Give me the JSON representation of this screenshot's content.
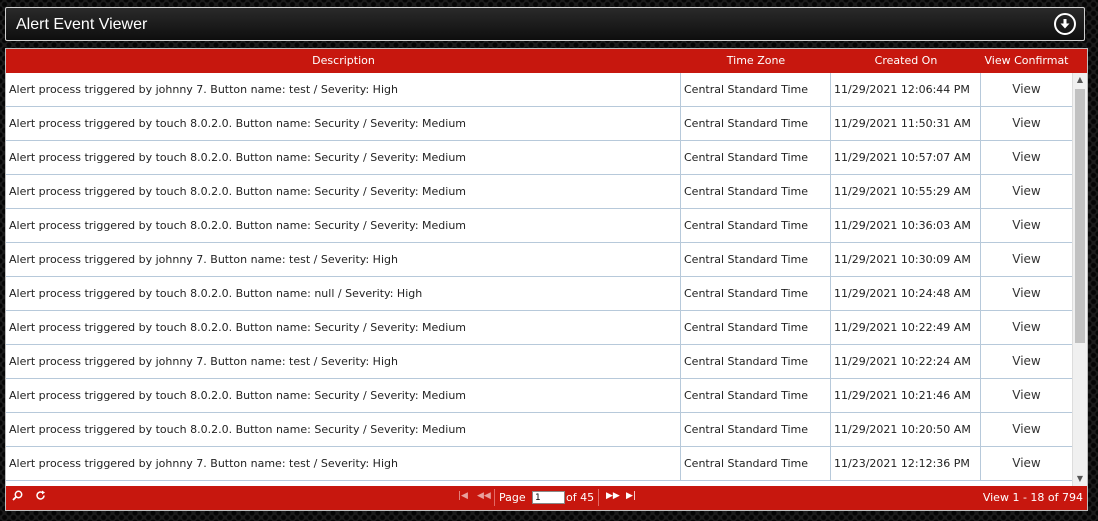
{
  "window": {
    "title": "Alert Event Viewer"
  },
  "icons": {
    "download": "download-circle-icon",
    "search": "search-icon",
    "refresh": "refresh-icon"
  },
  "columns": [
    "Description",
    "Time Zone",
    "Created On",
    "View Confirmat"
  ],
  "rows": [
    [
      "Alert process triggered by johnny 7.  Button name: test / Severity: High",
      "Central Standard Time",
      "11/29/2021 12:06:44 PM",
      "View"
    ],
    [
      "Alert process triggered by touch 8.0.2.0.  Button name: Security / Severity: Medium",
      "Central Standard Time",
      "11/29/2021 11:50:31 AM",
      "View"
    ],
    [
      "Alert process triggered by touch 8.0.2.0.  Button name: Security / Severity: Medium",
      "Central Standard Time",
      "11/29/2021 10:57:07 AM",
      "View"
    ],
    [
      "Alert process triggered by touch 8.0.2.0.  Button name: Security / Severity: Medium",
      "Central Standard Time",
      "11/29/2021 10:55:29 AM",
      "View"
    ],
    [
      "Alert process triggered by touch 8.0.2.0.  Button name: Security / Severity: Medium",
      "Central Standard Time",
      "11/29/2021 10:36:03 AM",
      "View"
    ],
    [
      "Alert process triggered by johnny 7.  Button name: test / Severity: High",
      "Central Standard Time",
      "11/29/2021 10:30:09 AM",
      "View"
    ],
    [
      "Alert process triggered by touch 8.0.2.0.  Button name: null / Severity: High",
      "Central Standard Time",
      "11/29/2021 10:24:48 AM",
      "View"
    ],
    [
      "Alert process triggered by touch 8.0.2.0.  Button name: Security / Severity: Medium",
      "Central Standard Time",
      "11/29/2021 10:22:49 AM",
      "View"
    ],
    [
      "Alert process triggered by johnny 7.  Button name: test / Severity: High",
      "Central Standard Time",
      "11/29/2021 10:22:24 AM",
      "View"
    ],
    [
      "Alert process triggered by touch 8.0.2.0.  Button name: Security / Severity: Medium",
      "Central Standard Time",
      "11/29/2021 10:21:46 AM",
      "View"
    ],
    [
      "Alert process triggered by touch 8.0.2.0.  Button name: Security / Severity: Medium",
      "Central Standard Time",
      "11/29/2021 10:20:50 AM",
      "View"
    ],
    [
      "Alert process triggered by johnny 7.  Button name: test / Severity: High",
      "Central Standard Time",
      "11/23/2021 12:12:36 PM",
      "View"
    ]
  ],
  "pager": {
    "page_label": "Page",
    "current_page": "1",
    "of_label": "of 45",
    "view_count": "View 1 - 18 of 794"
  },
  "colors": {
    "accent": "#c7170e",
    "grid_line": "#b7c9da"
  }
}
